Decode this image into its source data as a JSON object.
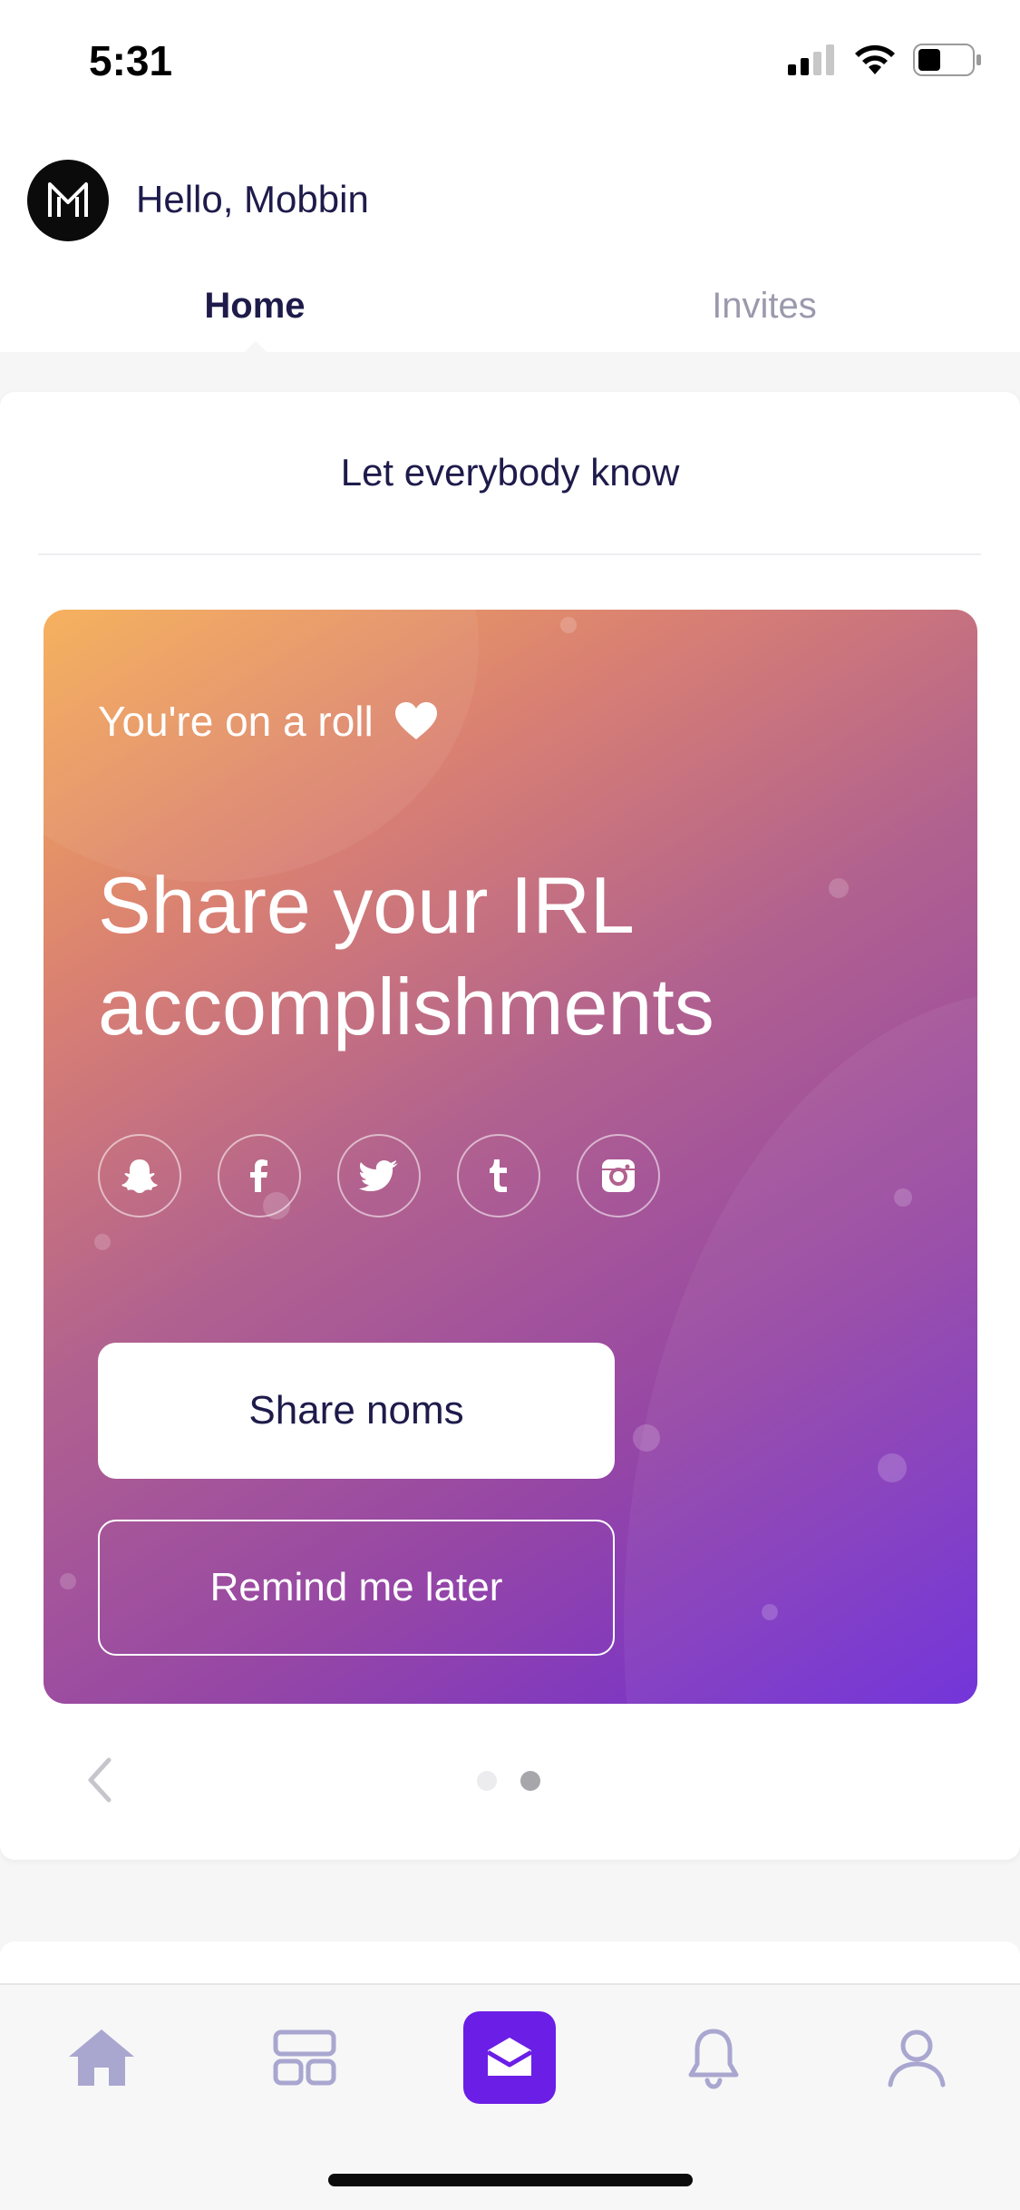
{
  "status_bar": {
    "time": "5:31"
  },
  "header": {
    "greeting": "Hello, Mobbin",
    "tabs": [
      {
        "label": "Home",
        "active": true
      },
      {
        "label": "Invites",
        "active": false
      }
    ]
  },
  "card": {
    "title": "Let everybody know",
    "promo": {
      "eyebrow": "You're on a roll",
      "headline": "Share your IRL accomplishments",
      "social_icons": [
        "snapchat-icon",
        "facebook-icon",
        "twitter-icon",
        "tumblr-icon",
        "instagram-icon"
      ],
      "primary_button": "Share noms",
      "secondary_button": "Remind me later"
    },
    "pager": {
      "pages": 2,
      "active_index": 1
    }
  },
  "tabbar": {
    "items": [
      "home-icon",
      "collection-icon",
      "inbox-icon",
      "bell-icon",
      "profile-icon"
    ],
    "active_index": 2
  },
  "colors": {
    "accent": "#6b1ee6",
    "text_dark": "#1e1b4b",
    "gradient_start": "#f6ad55",
    "gradient_end": "#6c2bd9"
  }
}
